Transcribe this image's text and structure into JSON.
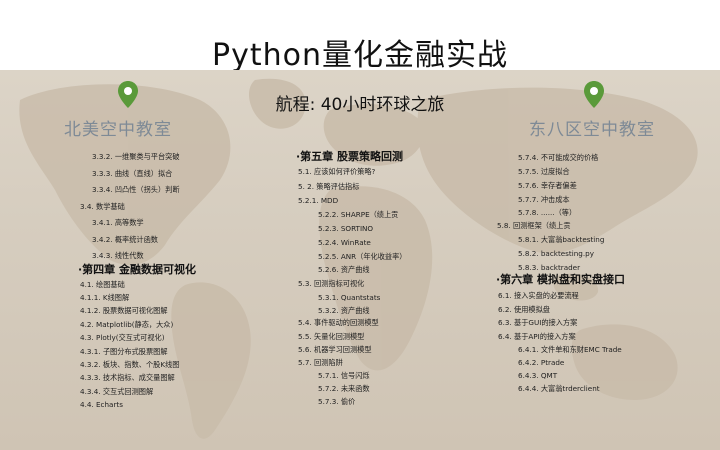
{
  "title": "Python量化金融实战",
  "subtitle": "航程: 40小时环球之旅",
  "classrooms": {
    "left": "北美空中教室",
    "right": "东八区空中教室"
  },
  "colors": {
    "pin": "#5a9a3a",
    "classroom_text": "#7e8a96",
    "map": "#d8cfc1"
  },
  "pin_icon": "map-pin",
  "columns": {
    "left": [
      "3.3.2. 一维聚类与平台突破",
      "3.3.3. 曲线（直线）拟合",
      "3.3.4. 凹凸性（拐头）判断",
      "3.4. 数学基础",
      "3.4.1. 高等数学",
      "3.4.2. 概率统计函数",
      "3.4.3. 线性代数",
      "·第四章 金融数据可视化",
      "4.1. 绘图基础",
      "4.1.1. K线图解",
      "4.1.2. 股票数据可视化图解",
      "4.2. Matplotlib(静态，大众)",
      "4.3. Plotly(交互式可视化)",
      "4.3.1. 子图分布式股票图解",
      "4.3.2. 板块、指数、个股K线图",
      "4.3.3. 技术指标、成交量图解",
      "4.3.4. 交互式回测图解",
      "4.4. Echarts"
    ],
    "middle": [
      "·第五章 股票策略回测",
      "5.1. 应该如何评价策略?",
      "5. 2. 策略评估指标",
      "5.2.1. MDD",
      "5.2.2. SHARPE（绩上贡",
      "5.2.3. SORTINO",
      "5.2.4. WinRate",
      "5.2.5. ANR（年化收益率）",
      "5.2.6. 资产曲线",
      "5.3. 回测指标可视化",
      "5.3.1. Quantstats",
      "5.3.2. 资产曲线",
      "5.4. 事件驱动的回测模型",
      "5.5. 矢量化回测模型",
      "5.6. 机器学习回测模型",
      "5.7. 回测陷阱",
      "5.7.1. 信号闪烁",
      "5.7.2. 未来函数",
      "5.7.3. 偷价"
    ],
    "right": [
      "5.7.4. 不可能成交的价格",
      "5.7.5. 过度拟合",
      "5.7.6. 幸存者偏差",
      "5.7.7. 冲击成本",
      "5.7.8. ......（等）",
      "5.8. 回测框架（绩上贡",
      "5.8.1. 大富翁backtesting",
      "5.8.2. backtesting.py",
      "5.8.3. backtrader",
      "·第六章 模拟盘和实盘接口",
      "6.1. 接入实盘的必要流程",
      "6.2. 使用模拟盘",
      "6.3. 基于GUI的接入方案",
      "6.4. 基于API的接入方案",
      "6.4.1. 文件单和东财EMC Trade",
      "6.4.2. Ptrade",
      "6.4.3. QMT",
      "6.4.4. 大富翁trderclient"
    ]
  }
}
